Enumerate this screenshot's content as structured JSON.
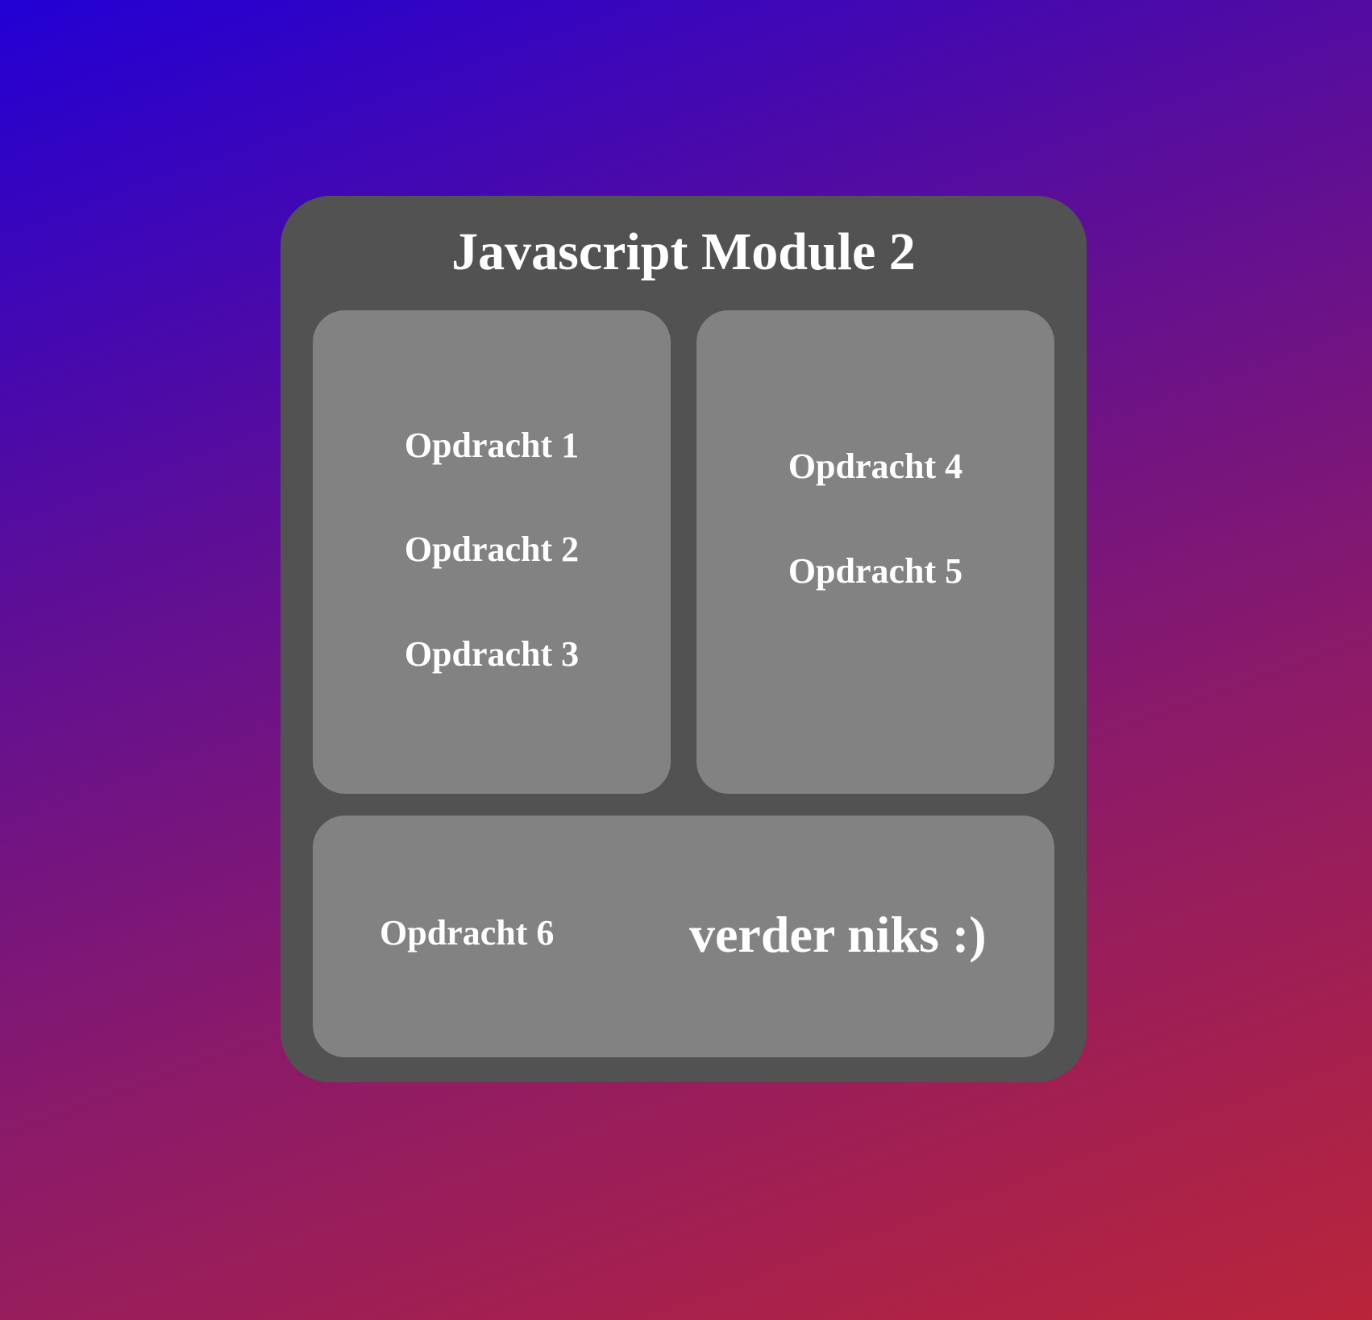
{
  "page": {
    "title": "Javascript Module 2"
  },
  "panels": {
    "left": {
      "links": [
        "Opdracht 1",
        "Opdracht 2",
        "Opdracht 3"
      ]
    },
    "right": {
      "links": [
        "Opdracht 4",
        "Opdracht 5"
      ]
    },
    "bottom": {
      "link": "Opdracht 6",
      "note": "verder niks :)"
    }
  },
  "colors": {
    "background_gradient": [
      "#2200d4",
      "#5c0e98",
      "#8a1a6a",
      "#b9253a"
    ],
    "card": "#525252",
    "panel": "#828282",
    "text": "#ffffff"
  }
}
